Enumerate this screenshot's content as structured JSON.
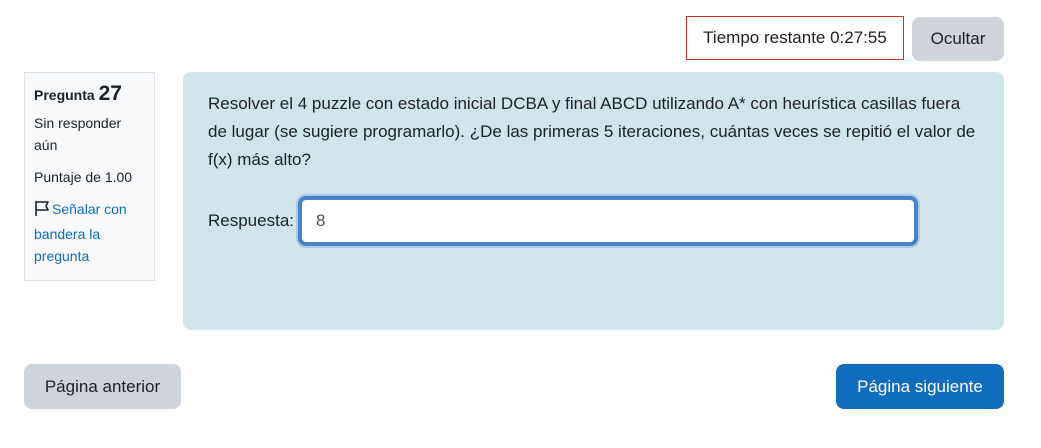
{
  "timer": {
    "label": "Tiempo restante 0:27:55"
  },
  "hide_button": "Ocultar",
  "question_info": {
    "label": "Pregunta",
    "number": "27",
    "status": "Sin responder aún",
    "grade": "Puntaje de 1.00",
    "flag_link": "Señalar con bandera la pregunta"
  },
  "question": {
    "text": "Resolver el 4 puzzle con estado inicial DCBA y final ABCD utilizando A* con heurística casillas fuera de lugar (se sugiere programarlo). ¿De las primeras 5 iteraciones, cuántas veces se repitió el valor de f(x) más alto?",
    "answer_label": "Respuesta:",
    "answer_value": "8"
  },
  "nav": {
    "prev": "Página anterior",
    "next": "Página siguiente"
  }
}
